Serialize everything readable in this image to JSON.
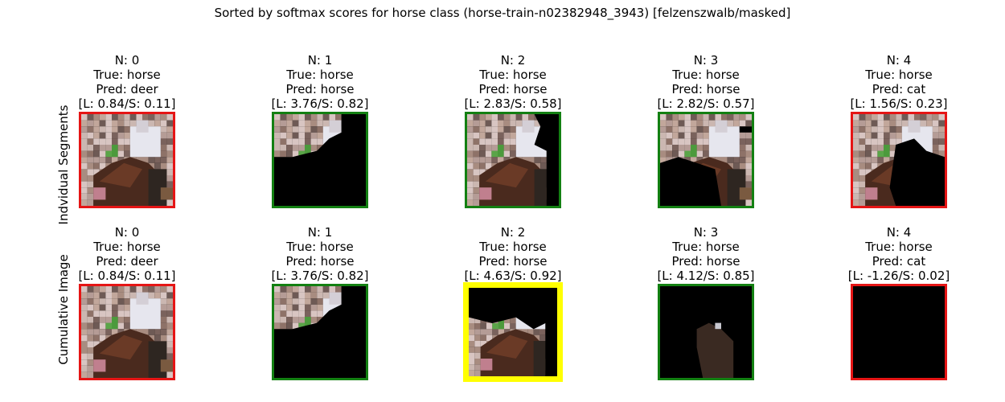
{
  "title": "Sorted by softmax scores for horse class (horse-train-n02382948_3943) [felzenszwalb/masked]",
  "chart_data": {
    "type": "image-grid",
    "rows": [
      {
        "label": "Indvidual Segments",
        "panels": [
          {
            "n": "N: 0",
            "true": "True: horse",
            "pred": "Pred: deer",
            "scores": "[L: 0.84/S: 0.11]",
            "correct": false,
            "highlight": false,
            "mask": "full"
          },
          {
            "n": "N: 1",
            "true": "True: horse",
            "pred": "Pred: horse",
            "scores": "[L: 3.76/S: 0.82]",
            "correct": true,
            "highlight": false,
            "mask": "seg1"
          },
          {
            "n": "N: 2",
            "true": "True: horse",
            "pred": "Pred: horse",
            "scores": "[L: 2.83/S: 0.58]",
            "correct": true,
            "highlight": false,
            "mask": "seg2"
          },
          {
            "n": "N: 3",
            "true": "True: horse",
            "pred": "Pred: horse",
            "scores": "[L: 2.82/S: 0.57]",
            "correct": true,
            "highlight": false,
            "mask": "seg3"
          },
          {
            "n": "N: 4",
            "true": "True: horse",
            "pred": "Pred: cat",
            "scores": "[L: 1.56/S: 0.23]",
            "correct": false,
            "highlight": false,
            "mask": "seg4"
          }
        ]
      },
      {
        "label": "Cumulative Image",
        "panels": [
          {
            "n": "N: 0",
            "true": "True: horse",
            "pred": "Pred: deer",
            "scores": "[L: 0.84/S: 0.11]",
            "correct": false,
            "highlight": false,
            "mask": "full"
          },
          {
            "n": "N: 1",
            "true": "True: horse",
            "pred": "Pred: horse",
            "scores": "[L: 3.76/S: 0.82]",
            "correct": true,
            "highlight": false,
            "mask": "seg1"
          },
          {
            "n": "N: 2",
            "true": "True: horse",
            "pred": "Pred: horse",
            "scores": "[L: 4.63/S: 0.92]",
            "correct": true,
            "highlight": true,
            "mask": "cum2"
          },
          {
            "n": "N: 3",
            "true": "True: horse",
            "pred": "Pred: horse",
            "scores": "[L: 4.12/S: 0.85]",
            "correct": true,
            "highlight": false,
            "mask": "cum3"
          },
          {
            "n": "N: 4",
            "true": "True: horse",
            "pred": "Pred: cat",
            "scores": "[L: -1.26/S: 0.02]",
            "correct": false,
            "highlight": false,
            "mask": "empty"
          }
        ]
      }
    ]
  },
  "colors": {
    "correct": "#138012",
    "incorrect": "#e51515",
    "highlight": "#ffff00",
    "masked": "#000000"
  }
}
